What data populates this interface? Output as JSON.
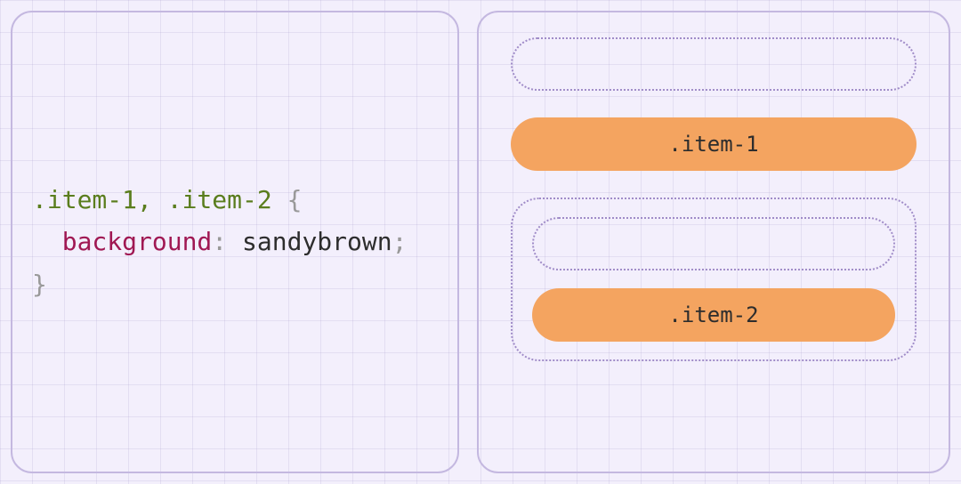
{
  "code": {
    "selector": ".item-1, .item-2",
    "brace_open": "{",
    "prop": "background",
    "colon": ":",
    "value": "sandybrown",
    "semicolon": ";",
    "brace_close": "}"
  },
  "demo": {
    "item1_label": ".item-1",
    "item2_label": ".item-2"
  },
  "colors": {
    "pill_bg": "#f4a460"
  }
}
